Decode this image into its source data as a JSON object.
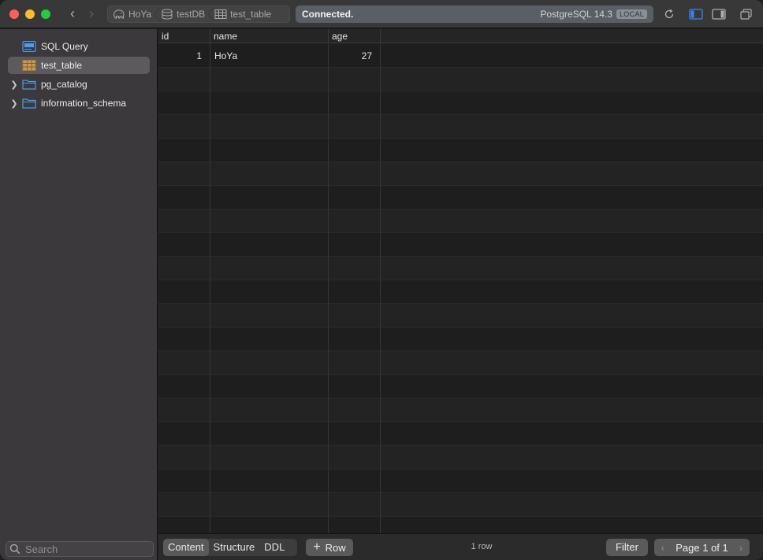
{
  "titlebar": {
    "breadcrumbs": [
      {
        "label": "HoYa",
        "icon": "elephant-icon"
      },
      {
        "label": "testDB",
        "icon": "database-icon"
      },
      {
        "label": "test_table",
        "icon": "table-icon"
      }
    ],
    "status": {
      "text": "Connected.",
      "engine": "PostgreSQL 14.3",
      "badge": "LOCAL"
    }
  },
  "sidebar": {
    "items": [
      {
        "label": "SQL Query",
        "icon": "sql-query-icon",
        "selected": false,
        "expandable": false
      },
      {
        "label": "test_table",
        "icon": "table-icon",
        "selected": true,
        "expandable": false
      },
      {
        "label": "pg_catalog",
        "icon": "folder-icon",
        "selected": false,
        "expandable": true
      },
      {
        "label": "information_schema",
        "icon": "folder-icon",
        "selected": false,
        "expandable": true
      }
    ],
    "search_placeholder": "Search"
  },
  "table": {
    "columns": [
      "id",
      "name",
      "age"
    ],
    "rows": [
      {
        "id": "1",
        "name": "HoYa",
        "age": "27"
      }
    ]
  },
  "bottombar": {
    "tabs": [
      "Content",
      "Structure",
      "DDL"
    ],
    "active_tab": "Content",
    "add_row_label": "Row",
    "row_count": "1 row",
    "filter_label": "Filter",
    "pagination": "Page 1 of 1"
  },
  "colors": {
    "status_bg": "#5a5f66",
    "sidebar_bg": "#3b393b",
    "accent_blue": "#3b82f6"
  }
}
